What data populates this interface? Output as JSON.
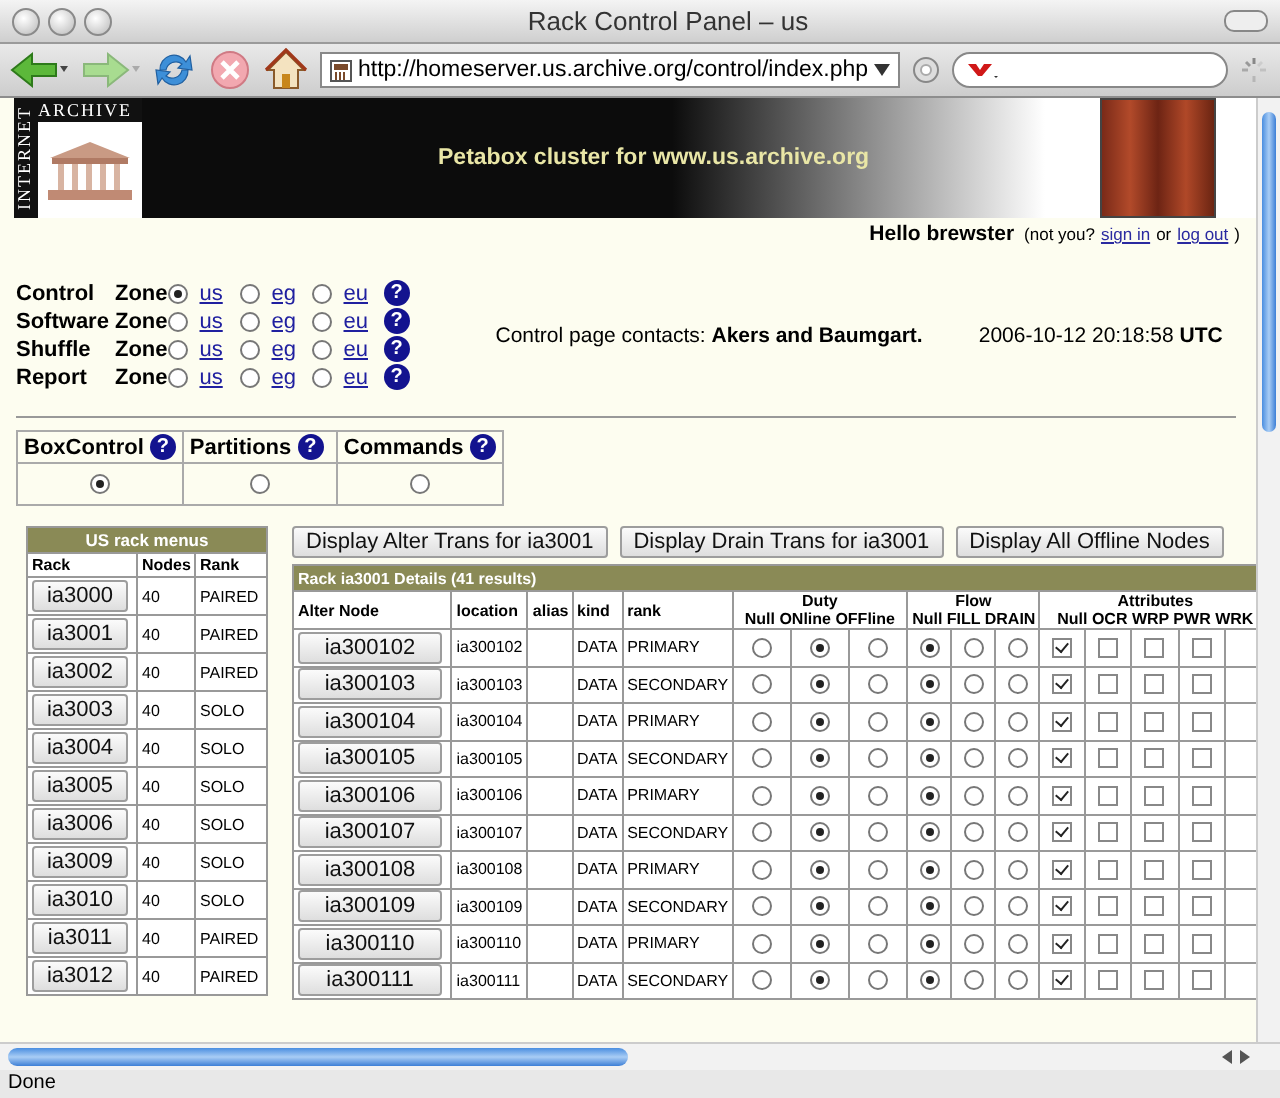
{
  "window": {
    "title": "Rack Control Panel – us"
  },
  "toolbar": {
    "url": "http://homeserver.us.archive.org/control/index.php"
  },
  "banner": {
    "logo_top": "ARCHIVE",
    "logo_side": "INTERNET",
    "title": "Petabox cluster for www.us.archive.org"
  },
  "greeting": {
    "hello": "Hello brewster",
    "parts": [
      {
        "kind": "text",
        "text": "(not you?"
      },
      {
        "kind": "link",
        "text": "sign in"
      },
      {
        "kind": "text",
        "text": "or"
      },
      {
        "kind": "link",
        "text": "log out"
      },
      {
        "kind": "text",
        "text": ")"
      }
    ]
  },
  "zones": [
    {
      "label": "Control",
      "suffix": "Zone",
      "help": "?",
      "options": [
        {
          "label": "us",
          "selected": true
        },
        {
          "label": "eg",
          "selected": false
        },
        {
          "label": "eu",
          "selected": false
        }
      ]
    },
    {
      "label": "Software",
      "suffix": "Zone",
      "help": "?",
      "options": [
        {
          "label": "us",
          "selected": false
        },
        {
          "label": "eg",
          "selected": false
        },
        {
          "label": "eu",
          "selected": false
        }
      ]
    },
    {
      "label": "Shuffle",
      "suffix": "Zone",
      "help": "?",
      "options": [
        {
          "label": "us",
          "selected": false
        },
        {
          "label": "eg",
          "selected": false
        },
        {
          "label": "eu",
          "selected": false
        }
      ]
    },
    {
      "label": "Report",
      "suffix": "Zone",
      "help": "?",
      "options": [
        {
          "label": "us",
          "selected": false
        },
        {
          "label": "eg",
          "selected": false
        },
        {
          "label": "eu",
          "selected": false
        }
      ]
    }
  ],
  "contacts": "Control page contacts: **Akers and Baumgart.**",
  "timestamp": "2006-10-12 20:18:58 **UTC**",
  "modes": [
    {
      "label": "BoxControl",
      "help": "?",
      "selected": true
    },
    {
      "label": "Partitions",
      "help": "?",
      "selected": false
    },
    {
      "label": "Commands",
      "help": "?",
      "selected": false
    }
  ],
  "rack_menus": {
    "title": "US rack menus",
    "columns": [
      "Rack",
      "Nodes",
      "Rank"
    ],
    "rows": [
      {
        "rack": "ia3000",
        "nodes": "40",
        "rank": "PAIRED"
      },
      {
        "rack": "ia3001",
        "nodes": "40",
        "rank": "PAIRED"
      },
      {
        "rack": "ia3002",
        "nodes": "40",
        "rank": "PAIRED"
      },
      {
        "rack": "ia3003",
        "nodes": "40",
        "rank": "SOLO"
      },
      {
        "rack": "ia3004",
        "nodes": "40",
        "rank": "SOLO"
      },
      {
        "rack": "ia3005",
        "nodes": "40",
        "rank": "SOLO"
      },
      {
        "rack": "ia3006",
        "nodes": "40",
        "rank": "SOLO"
      },
      {
        "rack": "ia3009",
        "nodes": "40",
        "rank": "SOLO"
      },
      {
        "rack": "ia3010",
        "nodes": "40",
        "rank": "SOLO"
      },
      {
        "rack": "ia3011",
        "nodes": "40",
        "rank": "PAIRED"
      },
      {
        "rack": "ia3012",
        "nodes": "40",
        "rank": "PAIRED"
      }
    ]
  },
  "actions": [
    "Display Alter Trans for ia3001",
    "Display Drain Trans for ia3001",
    "Display All Offline Nodes"
  ],
  "details": {
    "title": "Rack ia3001 Details (41 results)",
    "columns": [
      "Alter Node",
      "location",
      "alias",
      "kind",
      "rank"
    ],
    "groups": [
      {
        "title": "Duty",
        "labels": "Null ONline OFFline"
      },
      {
        "title": "Flow",
        "labels": "Null FILL DRAIN"
      },
      {
        "title": "Attributes",
        "labels": "Null OCR WRP PWR WRK"
      }
    ],
    "rows": [
      {
        "node": "ia300102",
        "location": "ia300102",
        "kind": "DATA",
        "rank": "PRIMARY",
        "duty": [
          {
            "selected": false
          },
          {
            "selected": true
          },
          {
            "selected": false
          }
        ],
        "flow": [
          {
            "selected": true
          },
          {
            "selected": false
          },
          {
            "selected": false
          }
        ],
        "attributes": [
          {
            "checked": true
          },
          {
            "checked": false
          },
          {
            "checked": false
          },
          {
            "checked": false
          }
        ]
      },
      {
        "node": "ia300103",
        "location": "ia300103",
        "kind": "DATA",
        "rank": "SECONDARY",
        "duty": [
          {
            "selected": false
          },
          {
            "selected": true
          },
          {
            "selected": false
          }
        ],
        "flow": [
          {
            "selected": true
          },
          {
            "selected": false
          },
          {
            "selected": false
          }
        ],
        "attributes": [
          {
            "checked": true
          },
          {
            "checked": false
          },
          {
            "checked": false
          },
          {
            "checked": false
          }
        ]
      },
      {
        "node": "ia300104",
        "location": "ia300104",
        "kind": "DATA",
        "rank": "PRIMARY",
        "duty": [
          {
            "selected": false
          },
          {
            "selected": true
          },
          {
            "selected": false
          }
        ],
        "flow": [
          {
            "selected": true
          },
          {
            "selected": false
          },
          {
            "selected": false
          }
        ],
        "attributes": [
          {
            "checked": true
          },
          {
            "checked": false
          },
          {
            "checked": false
          },
          {
            "checked": false
          }
        ]
      },
      {
        "node": "ia300105",
        "location": "ia300105",
        "kind": "DATA",
        "rank": "SECONDARY",
        "duty": [
          {
            "selected": false
          },
          {
            "selected": true
          },
          {
            "selected": false
          }
        ],
        "flow": [
          {
            "selected": true
          },
          {
            "selected": false
          },
          {
            "selected": false
          }
        ],
        "attributes": [
          {
            "checked": true
          },
          {
            "checked": false
          },
          {
            "checked": false
          },
          {
            "checked": false
          }
        ]
      },
      {
        "node": "ia300106",
        "location": "ia300106",
        "kind": "DATA",
        "rank": "PRIMARY",
        "duty": [
          {
            "selected": false
          },
          {
            "selected": true
          },
          {
            "selected": false
          }
        ],
        "flow": [
          {
            "selected": true
          },
          {
            "selected": false
          },
          {
            "selected": false
          }
        ],
        "attributes": [
          {
            "checked": true
          },
          {
            "checked": false
          },
          {
            "checked": false
          },
          {
            "checked": false
          }
        ]
      },
      {
        "node": "ia300107",
        "location": "ia300107",
        "kind": "DATA",
        "rank": "SECONDARY",
        "duty": [
          {
            "selected": false
          },
          {
            "selected": true
          },
          {
            "selected": false
          }
        ],
        "flow": [
          {
            "selected": true
          },
          {
            "selected": false
          },
          {
            "selected": false
          }
        ],
        "attributes": [
          {
            "checked": true
          },
          {
            "checked": false
          },
          {
            "checked": false
          },
          {
            "checked": false
          }
        ]
      },
      {
        "node": "ia300108",
        "location": "ia300108",
        "kind": "DATA",
        "rank": "PRIMARY",
        "duty": [
          {
            "selected": false
          },
          {
            "selected": true
          },
          {
            "selected": false
          }
        ],
        "flow": [
          {
            "selected": true
          },
          {
            "selected": false
          },
          {
            "selected": false
          }
        ],
        "attributes": [
          {
            "checked": true
          },
          {
            "checked": false
          },
          {
            "checked": false
          },
          {
            "checked": false
          }
        ]
      },
      {
        "node": "ia300109",
        "location": "ia300109",
        "kind": "DATA",
        "rank": "SECONDARY",
        "duty": [
          {
            "selected": false
          },
          {
            "selected": true
          },
          {
            "selected": false
          }
        ],
        "flow": [
          {
            "selected": true
          },
          {
            "selected": false
          },
          {
            "selected": false
          }
        ],
        "attributes": [
          {
            "checked": true
          },
          {
            "checked": false
          },
          {
            "checked": false
          },
          {
            "checked": false
          }
        ]
      },
      {
        "node": "ia300110",
        "location": "ia300110",
        "kind": "DATA",
        "rank": "PRIMARY",
        "duty": [
          {
            "selected": false
          },
          {
            "selected": true
          },
          {
            "selected": false
          }
        ],
        "flow": [
          {
            "selected": true
          },
          {
            "selected": false
          },
          {
            "selected": false
          }
        ],
        "attributes": [
          {
            "checked": true
          },
          {
            "checked": false
          },
          {
            "checked": false
          },
          {
            "checked": false
          }
        ]
      },
      {
        "node": "ia300111",
        "location": "ia300111",
        "kind": "DATA",
        "rank": "SECONDARY",
        "duty": [
          {
            "selected": false
          },
          {
            "selected": true
          },
          {
            "selected": false
          }
        ],
        "flow": [
          {
            "selected": true
          },
          {
            "selected": false
          },
          {
            "selected": false
          }
        ],
        "attributes": [
          {
            "checked": true
          },
          {
            "checked": false
          },
          {
            "checked": false
          },
          {
            "checked": false
          }
        ]
      }
    ]
  },
  "status_bar": {
    "text": "Done"
  }
}
